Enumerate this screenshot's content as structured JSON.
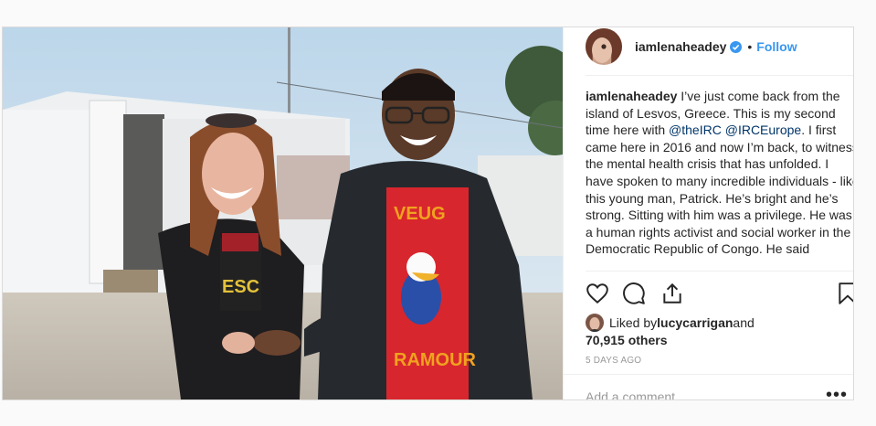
{
  "post": {
    "author": {
      "username": "iamlenaheadey",
      "verified": true,
      "follow_label": "Follow",
      "separator": "•"
    },
    "caption": {
      "username": "iamlenaheadey",
      "text_1": " I’ve just come back from the island of Lesvos, Greece. This is my second time here with ",
      "mention_1": "@theIRC",
      "text_2": " ",
      "mention_2": "@IRCEurope",
      "text_3": ". I first came here in 2016 and now I’m back, to witness the mental health crisis that has unfolded. I have spoken to many incredible individuals - like this young man, Patrick. He’s bright and he’s strong. Sitting with him was a privilege. He was a human rights activist and social worker in the Democratic Republic of Congo. He said"
    },
    "actions": {
      "like_icon": "heart-icon",
      "comment_icon": "comment-icon",
      "share_icon": "share-icon",
      "save_icon": "bookmark-icon"
    },
    "likes": {
      "prefix": "Liked by ",
      "user": "lucycarrigan",
      "and": " and",
      "others": "70,915 others"
    },
    "timestamp": "5 DAYS AGO",
    "comment": {
      "placeholder": "Add a comment…",
      "more_label": "•••"
    },
    "photo": {
      "shirt_text_top": "VEUG",
      "shirt_text_bottom": "RAMOUR",
      "tshirt_text_left": "ESC"
    },
    "colors": {
      "accent": "#3897f0",
      "mention": "#003569",
      "muted": "#999999"
    }
  }
}
